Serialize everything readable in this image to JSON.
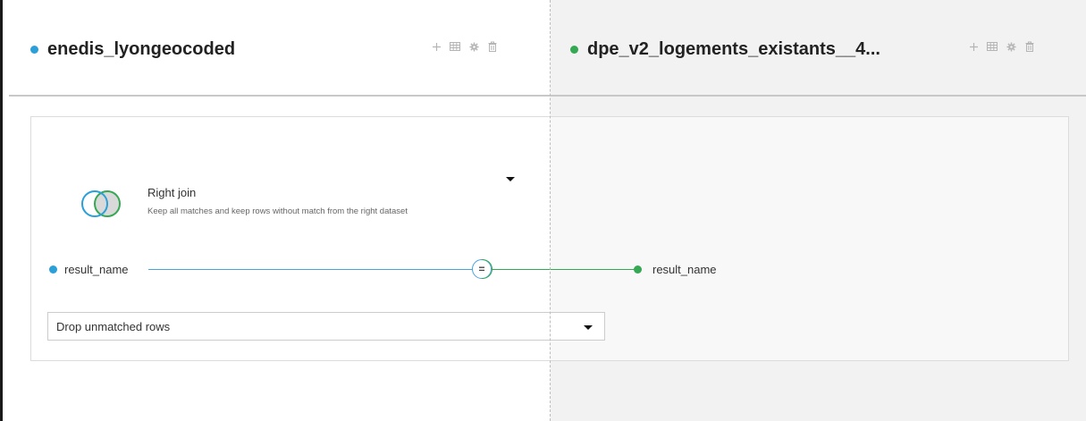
{
  "datasets": {
    "left": {
      "name": "enedis_lyongeocoded",
      "color": "#2a9fd8"
    },
    "right": {
      "name": "dpe_v2_logements_existants__4...",
      "color": "#34a853"
    },
    "tools": [
      {
        "icon": "plus-icon"
      },
      {
        "icon": "table-icon"
      },
      {
        "icon": "gear-icon"
      },
      {
        "icon": "trash-icon"
      }
    ]
  },
  "join": {
    "type_label": "Right join",
    "type_description": "Keep all matches and keep rows without match from the right dataset",
    "condition": {
      "left_column": "result_name",
      "operator": "=",
      "right_column": "result_name"
    },
    "unmatched_option": "Drop unmatched rows"
  }
}
